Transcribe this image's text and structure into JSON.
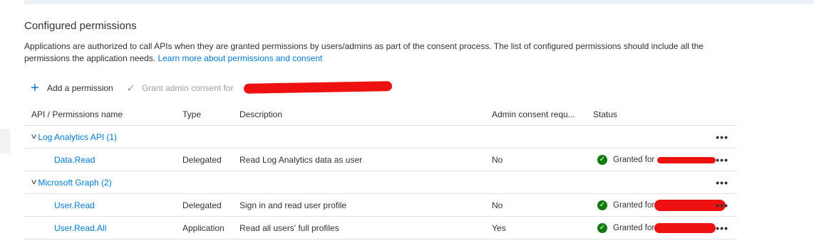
{
  "section": {
    "title": "Configured permissions",
    "description": "Applications are authorized to call APIs when they are granted permissions by users/admins as part of the consent process. The list of configured permissions should include all the permissions the application needs.",
    "learn_more": "Learn more about permissions and consent"
  },
  "toolbar": {
    "add_label": "Add a permission",
    "grant_label": "Grant admin consent for"
  },
  "table": {
    "headers": {
      "api": "API / Permissions name",
      "type": "Type",
      "description": "Description",
      "admin": "Admin consent requ...",
      "status": "Status"
    },
    "groups": [
      {
        "name": "Log Analytics API (1)",
        "rows": [
          {
            "name": "Data.Read",
            "type": "Delegated",
            "description": "Read Log Analytics data as user",
            "admin": "No",
            "status": "Granted for"
          }
        ]
      },
      {
        "name": "Microsoft Graph (2)",
        "rows": [
          {
            "name": "User.Read",
            "type": "Delegated",
            "description": "Sign in and read user profile",
            "admin": "No",
            "status": "Granted for"
          },
          {
            "name": "User.Read.All",
            "type": "Application",
            "description": "Read all users' full profiles",
            "admin": "Yes",
            "status": "Granted for"
          }
        ]
      }
    ]
  },
  "icons": {
    "add": "plus-icon",
    "grant": "checkmark-icon",
    "collapse": "chevron-down-icon",
    "status": "check-circle-icon",
    "more": "more-icon"
  },
  "colors": {
    "accent": "#0078d4",
    "success": "#107c10",
    "redaction": "#ee1111"
  }
}
